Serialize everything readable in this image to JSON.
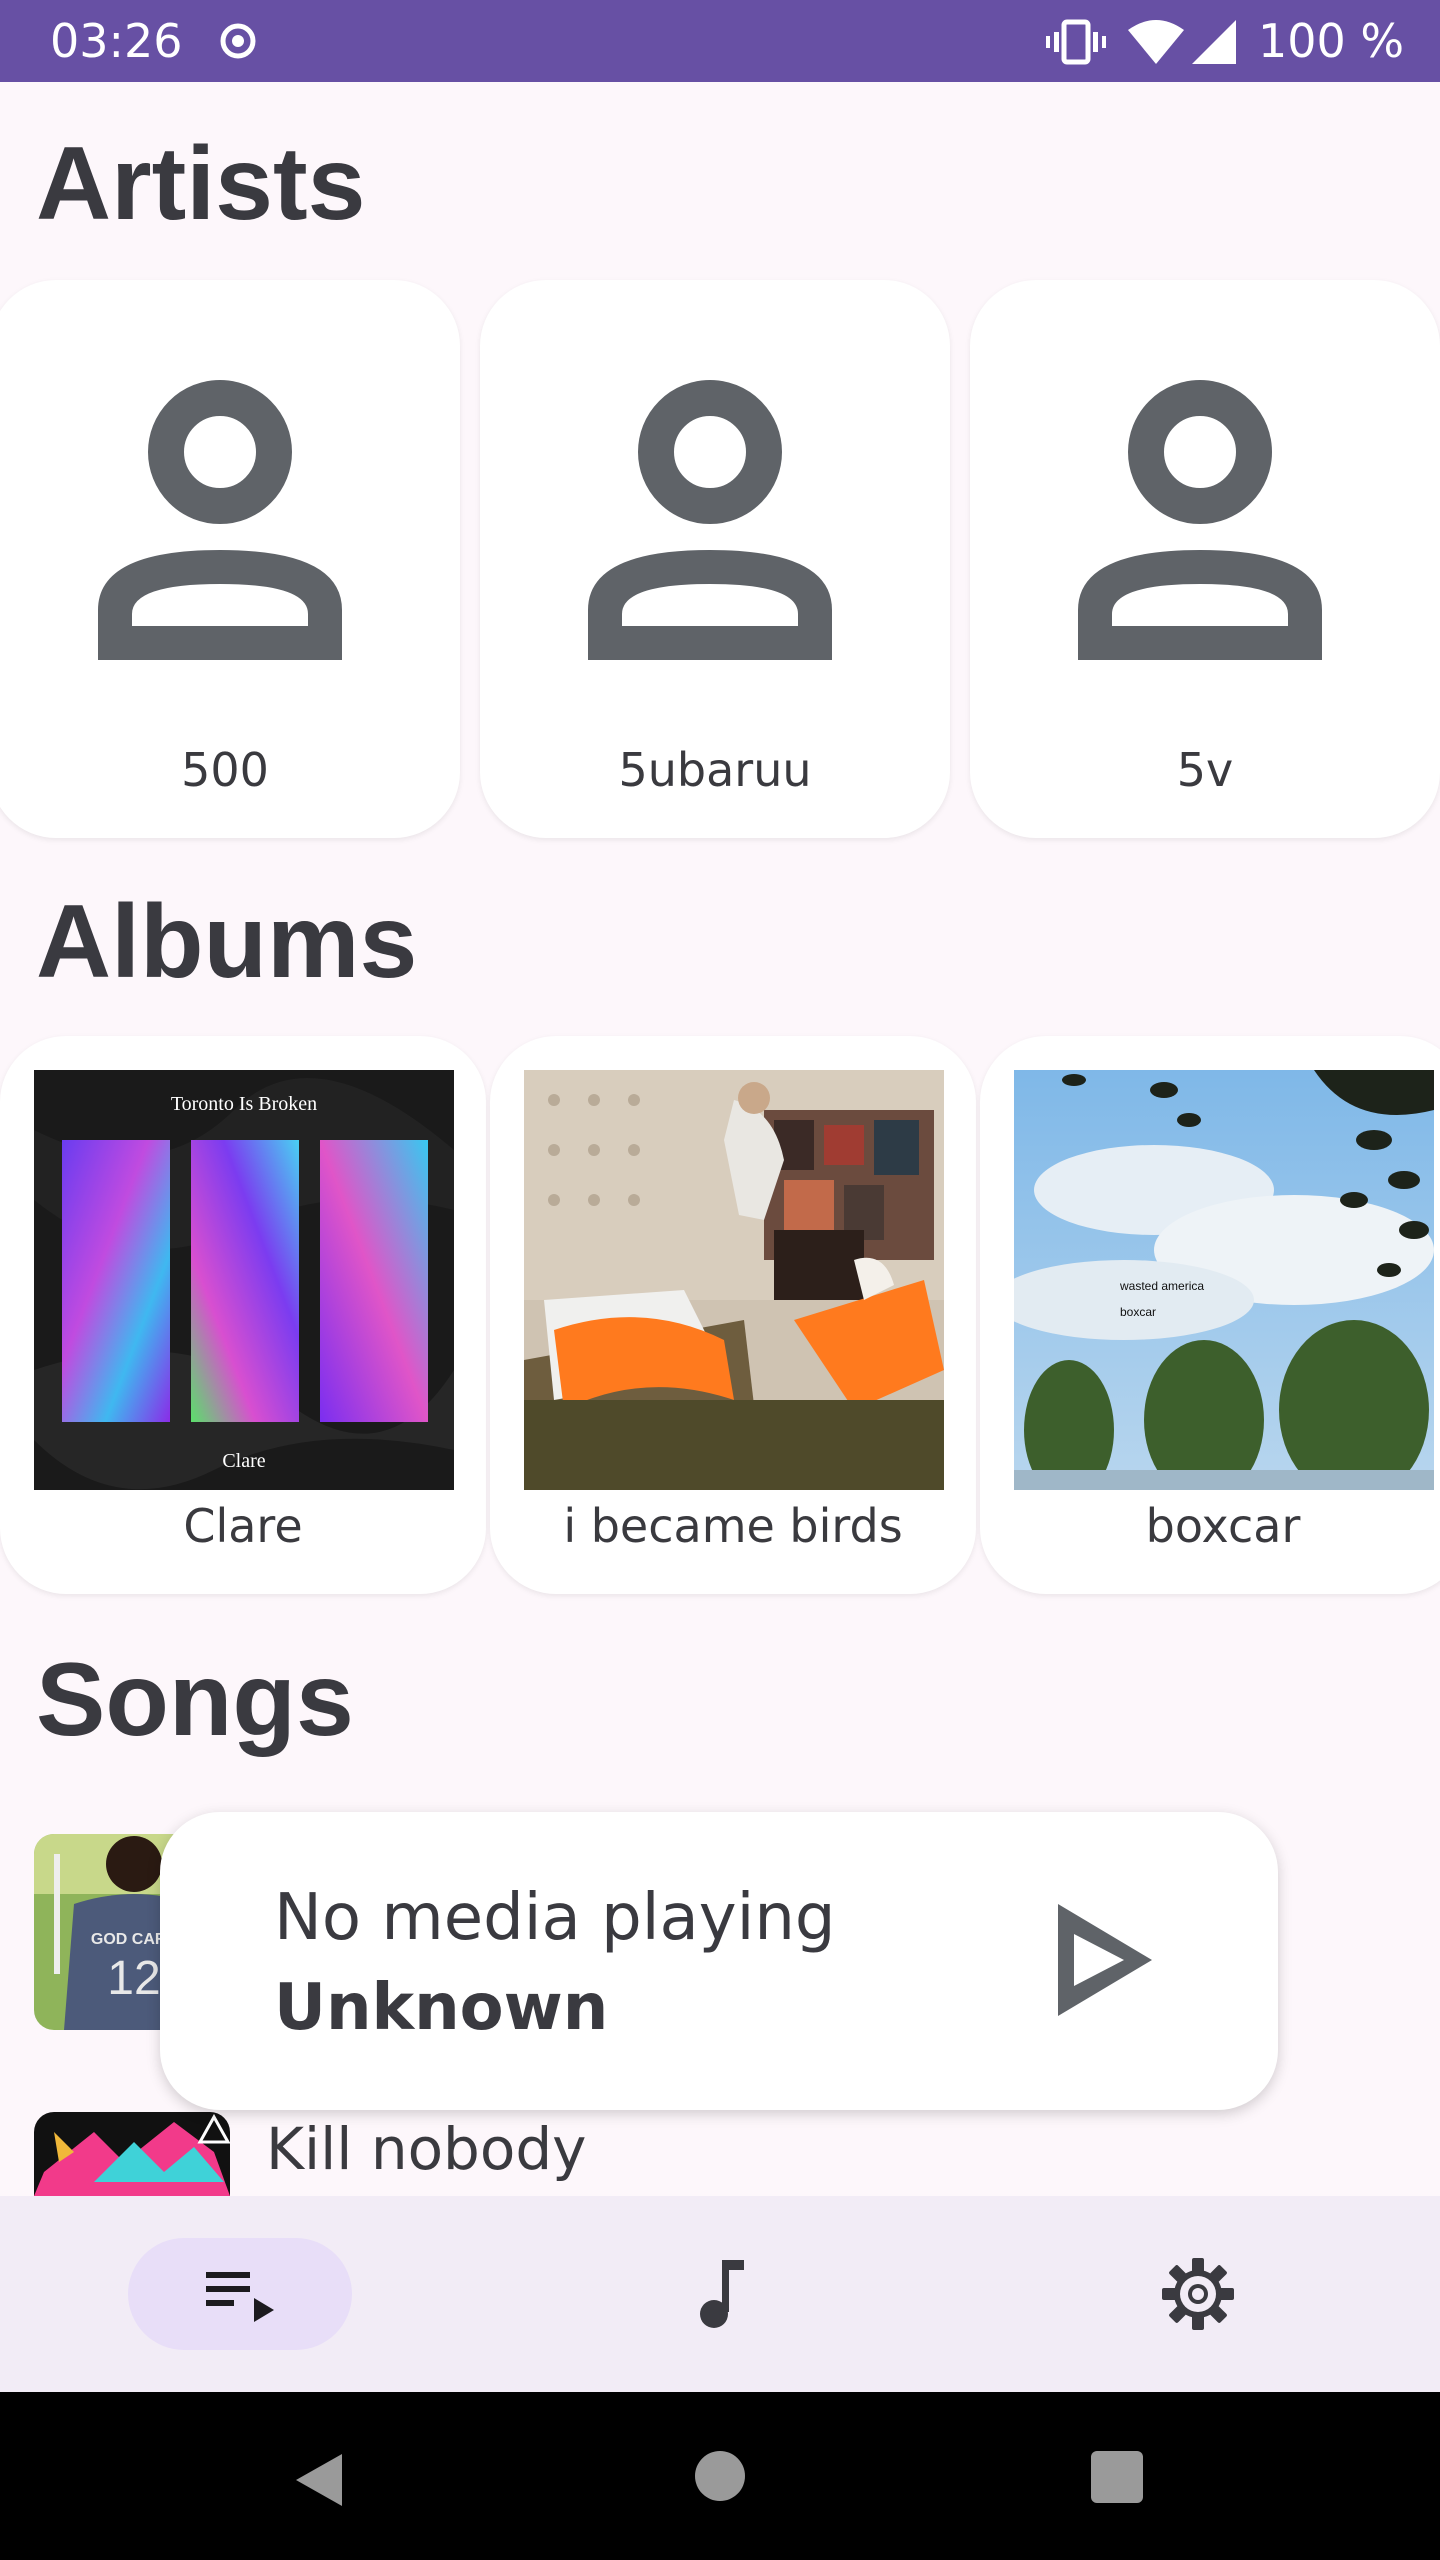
{
  "status_bar": {
    "time": "03:26",
    "battery": "100 %"
  },
  "sections": {
    "artists_title": "Artists",
    "albums_title": "Albums",
    "songs_title": "Songs"
  },
  "artists": [
    {
      "name": "500"
    },
    {
      "name": "5ubaruu"
    },
    {
      "name": "5v"
    }
  ],
  "albums": [
    {
      "name": "Clare",
      "art_title": "Toronto Is Broken",
      "art_subtitle": "Clare"
    },
    {
      "name": "i became birds"
    },
    {
      "name": "boxcar",
      "art_line1": "wasted america",
      "art_line2": "boxcar"
    }
  ],
  "songs": [
    {
      "title": "",
      "thumb_text": "GOD CARE",
      "thumb_number": "12"
    },
    {
      "title": "Kill nobody"
    }
  ],
  "now_playing": {
    "title": "No media playing",
    "artist": "Unknown"
  },
  "colors": {
    "status_bar": "#6750a4",
    "background": "#fdf7fb",
    "nav_background": "#f2ecf6",
    "nav_active_pill": "#e8def8",
    "icon_gray": "#5f6368"
  },
  "icons": {
    "status": [
      "record-dot-icon",
      "vibrate-icon",
      "wifi-icon",
      "signal-icon"
    ],
    "artist": "person-icon",
    "play": "play-icon",
    "nav": [
      "queue-music-icon",
      "music-note-icon",
      "settings-gear-icon"
    ],
    "system": [
      "back-icon",
      "home-icon",
      "recents-icon"
    ]
  }
}
